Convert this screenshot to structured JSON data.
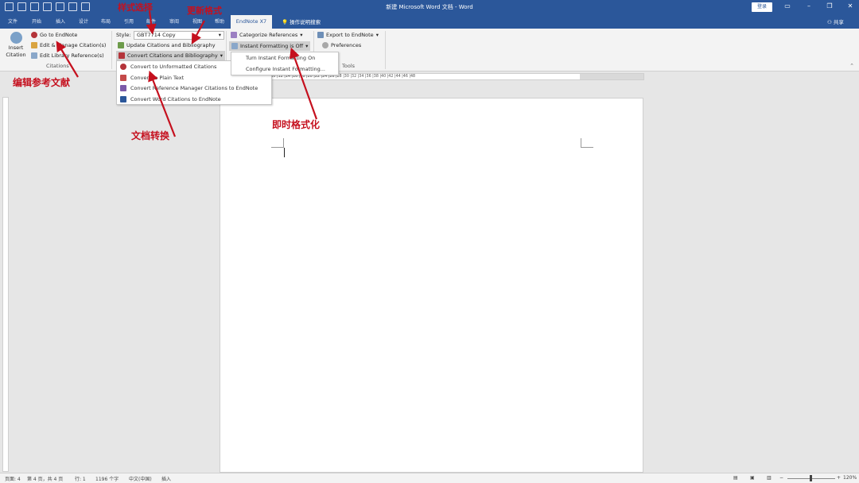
{
  "window": {
    "title": "新建 Microsoft Word 文档 - Word",
    "signin": "登录",
    "share": "共享"
  },
  "tabs": [
    "文件",
    "开始",
    "插入",
    "设计",
    "布局",
    "引用",
    "邮件",
    "审阅",
    "视图",
    "帮助"
  ],
  "active_tab": "EndNote X7",
  "help_search": "操作说明搜索",
  "ribbon": {
    "insert_citation": [
      "Insert",
      "Citation"
    ],
    "go_to_endnote": "Go to EndNote",
    "edit_manage": "Edit & Manage Citation(s)",
    "edit_library_ref": "Edit Library Reference(s)",
    "citations_group": "Citations",
    "style_label": "Style:",
    "style_value": "GBT7714 Copy",
    "update_citations": "Update Citations and Bibliography",
    "convert_citations": "Convert Citations and Bibliography",
    "categorize": "Categorize References",
    "instant_formatting": "Instant Formatting is Off",
    "export": "Export to EndNote",
    "preferences": "Preferences",
    "tools_group": "Tools"
  },
  "convert_menu": [
    "Convert to Unformatted Citations",
    "Convert to Plain Text",
    "Convert Reference Manager Citations to EndNote",
    "Convert Word Citations to EndNote"
  ],
  "instant_menu": [
    "Turn Instant Formatting On",
    "Configure Instant Formatting..."
  ],
  "annotations": {
    "edit_refs": "编辑参考文献",
    "style": "样式选择",
    "update": "更新格式",
    "convert": "文档转换",
    "instant": "即时格式化"
  },
  "ruler": "8 | 6 | 4 | 2 |  | 2 | 4 | 6 | 8 |10 |12 |14 |16 |18 |20 |22 |24 |26 |28 |30 |32 |34 |36 |38 |40 |42 |44 |46 |48",
  "status": {
    "page": "页面: 4",
    "pages": "第 4 页，共 4 页",
    "line": "行: 1",
    "words": "1196 个字",
    "lang": "中文(中国)",
    "mode": "插入",
    "zoom": "120%"
  },
  "colors": {
    "title_bar": "#2b579a",
    "annotation": "#c5101e"
  }
}
